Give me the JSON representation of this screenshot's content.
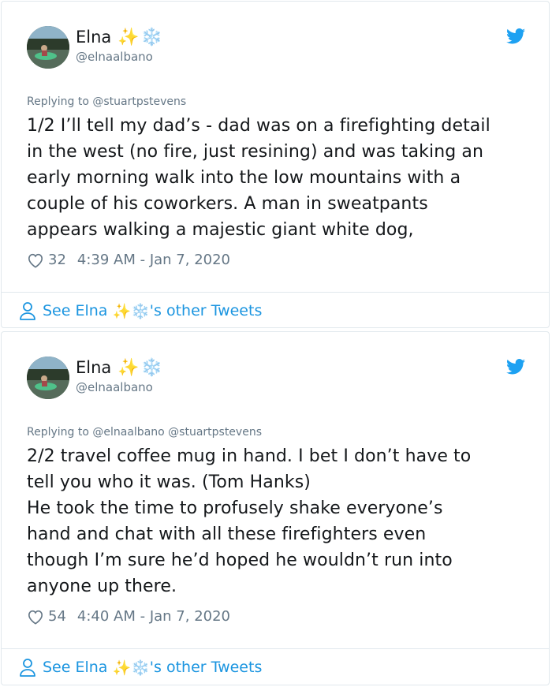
{
  "tweets": [
    {
      "author_name": "Elna",
      "name_emoji_1": "✨",
      "name_emoji_2": "❄️",
      "handle": "@elnaalbano",
      "replying_to": "Replying to @stuartpstevens",
      "text": "1/2 I’ll tell my dad’s - dad was on a firefighting detail\nin the west (no fire, just resining) and was taking an\nearly morning walk into the low mountains with a\ncouple of his coworkers. A man in sweatpants\nappears walking a majestic giant white dog,",
      "likes": "32",
      "timestamp": "4:39 AM - Jan 7, 2020",
      "see_more_prefix": "See Elna",
      "see_more_suffix": "'s other Tweets"
    },
    {
      "author_name": "Elna",
      "name_emoji_1": "✨",
      "name_emoji_2": "❄️",
      "handle": "@elnaalbano",
      "replying_to": "Replying to @elnaalbano @stuartpstevens",
      "text": "2/2 travel coffee mug in hand. I bet I don’t have to\ntell you who it was. (Tom Hanks)\nHe took the time to profusely shake everyone’s\nhand and chat with all these firefighters even\nthough I’m sure he’d hoped he wouldn’t run into\nanyone up there.",
      "likes": "54",
      "timestamp": "4:40 AM - Jan 7, 2020",
      "see_more_prefix": "See Elna",
      "see_more_suffix": "'s other Tweets"
    }
  ],
  "icons": {
    "bird": "twitter-bird-icon",
    "heart": "heart-outline-icon",
    "person": "person-outline-icon"
  },
  "colors": {
    "link_blue": "#1b95e0",
    "twitter_blue": "#1da1f2",
    "secondary_gray": "#657786",
    "border": "#e1e8ed"
  }
}
